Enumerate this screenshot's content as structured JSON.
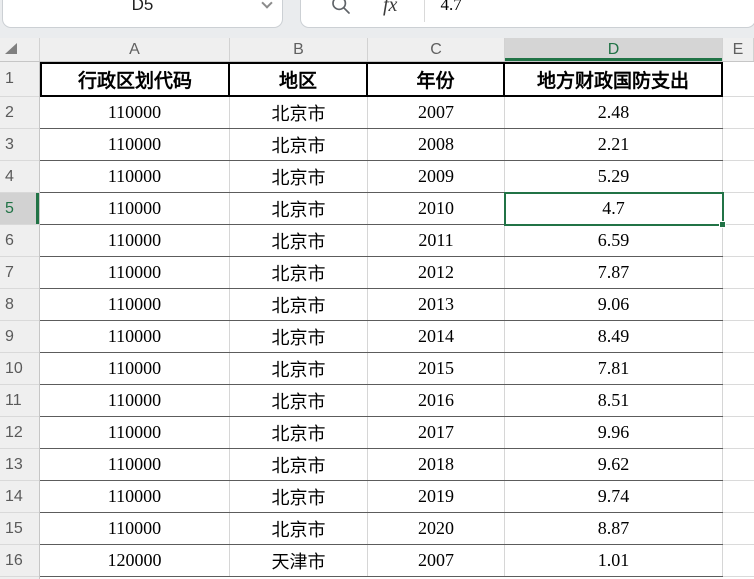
{
  "name_box": {
    "value": "D5"
  },
  "formula_bar": {
    "fx_label": "fx",
    "value": "4.7"
  },
  "sheet": {
    "column_letters": [
      "A",
      "B",
      "C",
      "D",
      "E"
    ],
    "selected_column": "D",
    "row_numbers": [
      "1",
      "2",
      "3",
      "4",
      "5",
      "6",
      "7",
      "8",
      "9",
      "10",
      "11",
      "12",
      "13",
      "14",
      "15",
      "16"
    ],
    "selected_row": "5",
    "selected_cell": {
      "reference": "D5",
      "value": "4.7"
    }
  },
  "table": {
    "headers": [
      "行政区划代码",
      "地区",
      "年份",
      "地方财政国防支出"
    ],
    "rows": [
      [
        "110000",
        "北京市",
        "2007",
        "2.48"
      ],
      [
        "110000",
        "北京市",
        "2008",
        "2.21"
      ],
      [
        "110000",
        "北京市",
        "2009",
        "5.29"
      ],
      [
        "110000",
        "北京市",
        "2010",
        "4.7"
      ],
      [
        "110000",
        "北京市",
        "2011",
        "6.59"
      ],
      [
        "110000",
        "北京市",
        "2012",
        "7.87"
      ],
      [
        "110000",
        "北京市",
        "2013",
        "9.06"
      ],
      [
        "110000",
        "北京市",
        "2014",
        "8.49"
      ],
      [
        "110000",
        "北京市",
        "2015",
        "7.81"
      ],
      [
        "110000",
        "北京市",
        "2016",
        "8.51"
      ],
      [
        "110000",
        "北京市",
        "2017",
        "9.96"
      ],
      [
        "110000",
        "北京市",
        "2018",
        "9.62"
      ],
      [
        "110000",
        "北京市",
        "2019",
        "9.74"
      ],
      [
        "110000",
        "北京市",
        "2020",
        "8.87"
      ],
      [
        "120000",
        "天津市",
        "2007",
        "1.01"
      ]
    ]
  },
  "icons": {
    "search": "magnifier-icon",
    "name_box_dropdown": "chevron-down-icon",
    "select_all": "select-all-triangle"
  },
  "colors": {
    "accent_green": "#217346",
    "header_bg": "#efefef",
    "selected_header_bg": "#d5d5d5",
    "grid_line": "#d6d6d6",
    "table_border": "#000000",
    "row_line": "#5c5c5c"
  }
}
